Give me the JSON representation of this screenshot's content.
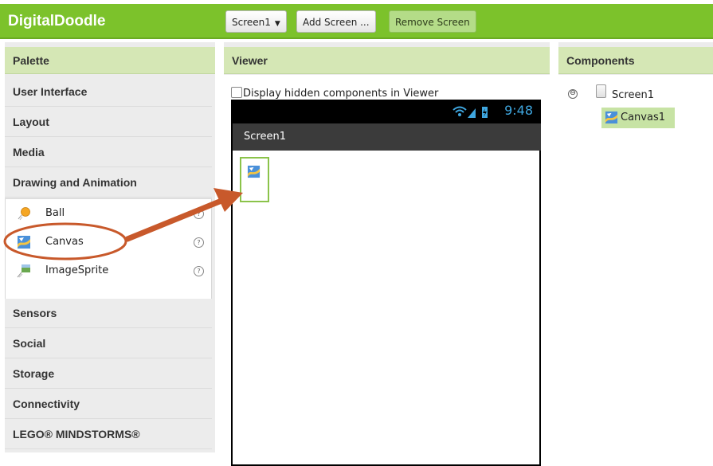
{
  "app": {
    "title": "DigitalDoodle"
  },
  "toolbar": {
    "screen_select": "Screen1",
    "add_screen": "Add Screen ...",
    "remove_screen": "Remove Screen"
  },
  "palette": {
    "header": "Palette",
    "categories": [
      "User Interface",
      "Layout",
      "Media",
      "Drawing and Animation",
      "Sensors",
      "Social",
      "Storage",
      "Connectivity",
      "LEGO® MINDSTORMS®"
    ],
    "items": [
      {
        "label": "Ball",
        "help": "?"
      },
      {
        "label": "Canvas",
        "help": "?"
      },
      {
        "label": "ImageSprite",
        "help": "?"
      }
    ]
  },
  "viewer": {
    "header": "Viewer",
    "hidden_toggle": "Display hidden components in Viewer",
    "status_time": "9:48",
    "screen_title": "Screen1"
  },
  "components": {
    "header": "Components",
    "tree_toggle": "⊖",
    "screen": "Screen1",
    "canvas": "Canvas1"
  },
  "colors": {
    "brand": "#7cc22b",
    "header_bg": "#d5e7b5",
    "selected": "#c7e3a4",
    "annotation": "#c8592b"
  }
}
